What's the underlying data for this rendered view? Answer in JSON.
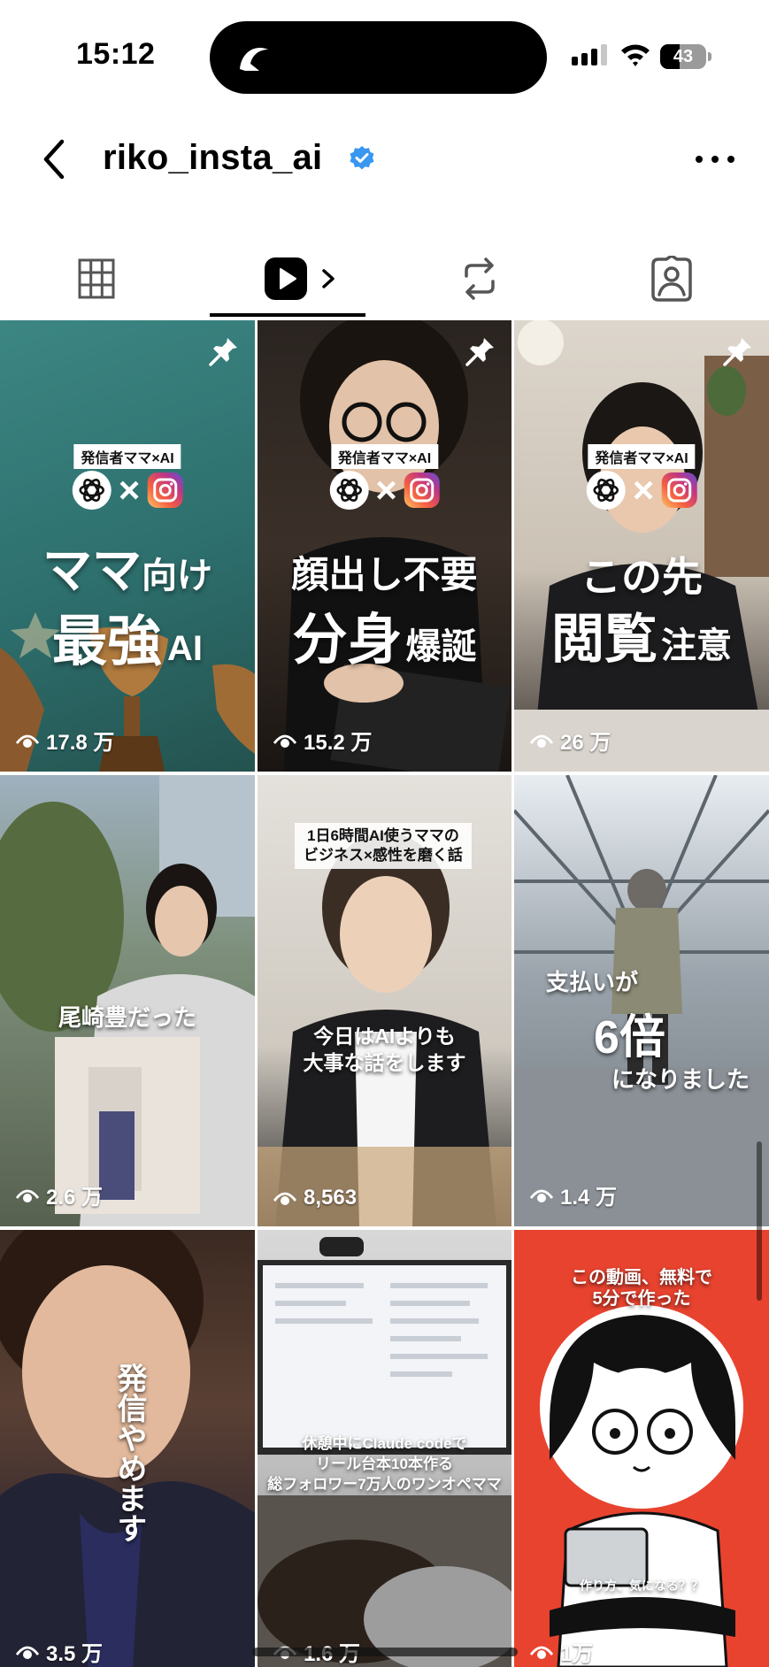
{
  "status_bar": {
    "time": "15:12",
    "battery": "43",
    "battery_level": 0.43
  },
  "header": {
    "username": "riko_insta_ai",
    "icons": [
      "back-arrow-icon",
      "verified-badge-icon",
      "more-options-icon"
    ]
  },
  "tabs": [
    {
      "name": "grid",
      "icon": "grid-icon",
      "active": false
    },
    {
      "name": "reels",
      "icon": "reels-icon",
      "active": true
    },
    {
      "name": "reposts",
      "icon": "repost-icon",
      "active": false
    },
    {
      "name": "tagged",
      "icon": "tagged-person-icon",
      "active": false
    }
  ],
  "tiles": [
    {
      "pinned": true,
      "views": "17.8 万",
      "badge": "発信者ママ×AI",
      "line1a": "ママ",
      "line1b": "向け",
      "line2a": "最強",
      "line2b": "AI"
    },
    {
      "pinned": true,
      "views": "15.2 万",
      "badge": "発信者ママ×AI",
      "line1": "顔出し不要",
      "line2a": "分身",
      "line2b": "爆誕"
    },
    {
      "pinned": true,
      "views": "26 万",
      "badge": "発信者ママ×AI",
      "line1": "この先",
      "line2a": "閲覧",
      "line2b": "注意"
    },
    {
      "views": "2.6 万",
      "caption": "尾崎豊だった"
    },
    {
      "views": "8,563",
      "caption_top": "1日6時間AI使うママの\nビジネス×感性を磨く話",
      "caption": "今日はAIよりも\n大事な話をします"
    },
    {
      "views": "1.4 万",
      "caption1": "支払いが",
      "caption2": "6倍",
      "caption3": "になりました"
    },
    {
      "views": "3.5 万",
      "caption": "発信やめます"
    },
    {
      "views": "1.6 万",
      "caption": "休憩中にClaude codeで\nリール台本10本作る\n総フォロワー7万人のワンオペママ"
    },
    {
      "views": "1万",
      "caption_top": "この動画、無料で\n5分で作った",
      "caption_bottom": "作り方、気になる？？"
    }
  ],
  "colors": {
    "accent_blue": "#3897f0",
    "tile3_red": "#e8432f",
    "tile1_teal": "#2f7a78"
  }
}
